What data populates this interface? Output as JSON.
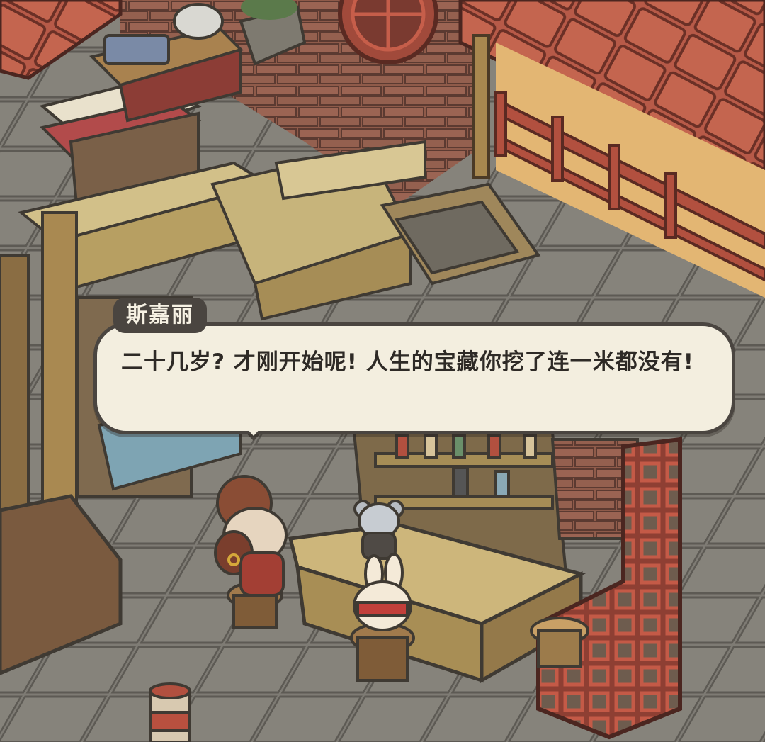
{
  "dialogue": {
    "speaker": "斯嘉丽",
    "text": "二十几岁? 才刚开始呢! 人生的宝藏你挖了连一米都没有!"
  }
}
